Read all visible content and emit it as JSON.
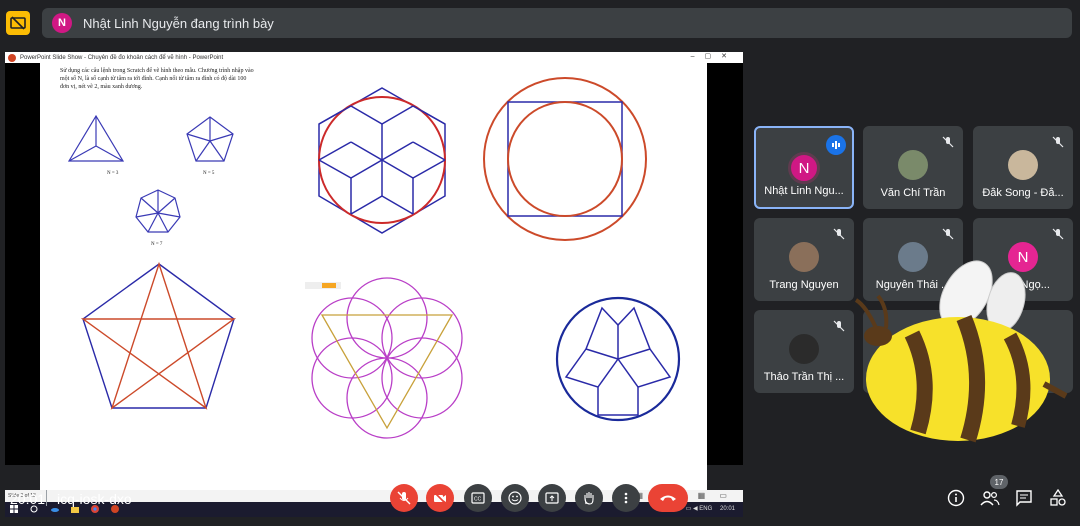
{
  "topbar": {
    "presenter_initial": "N",
    "presenter_text": "Nhật Linh Nguyễn đang trình bày",
    "presenter_color": "#d01884"
  },
  "powerpoint": {
    "title": "PowerPoint Slide Show  -  Chuyên đề đo khoản cách để vẽ hình  -  PowerPoint",
    "slide_text": "Sử dụng các câu lệnh trong Scratch để vẽ hình theo mẫu. Chương trình nhập vào một số N, là số cạnh từ tâm ra tới đỉnh. Cạnh nối từ tâm ra đỉnh có độ dài 100 đơn vị, nét vẽ 2, màu xanh dương.",
    "labels": {
      "n3": "N = 3",
      "n5": "N = 5",
      "n7": "N = 7"
    },
    "status": "Slide 3 of 13",
    "tray_lang": "ENG",
    "tray_time": "20:01"
  },
  "participants": [
    {
      "name": "Nhật Linh Ngu...",
      "initial": "N",
      "color": "#d01884",
      "speaking": true
    },
    {
      "name": "Văn Chí Trần",
      "initial": "",
      "color": "#7a8a6a"
    },
    {
      "name": "Đắk Song - Đắ...",
      "initial": "",
      "color": "#c9b79c"
    },
    {
      "name": "Trang Nguyen",
      "initial": "",
      "color": "#8a6f5a"
    },
    {
      "name": "Nguyễn Thái ...",
      "initial": "",
      "color": "#6b7b8b"
    },
    {
      "name": "...ng Ngọ...",
      "initial": "N",
      "color": "#e52592"
    },
    {
      "name": "Thảo Trần Thị ...",
      "initial": "",
      "color": "#2b2b2b"
    }
  ],
  "bottombar": {
    "time": "20:01",
    "meeting_code": "icq-iosk-dxo",
    "people_count": "17"
  },
  "colors": {
    "background": "#202124",
    "tile": "#3c4043",
    "red": "#ea4335",
    "accent": "#8ab4f8"
  }
}
